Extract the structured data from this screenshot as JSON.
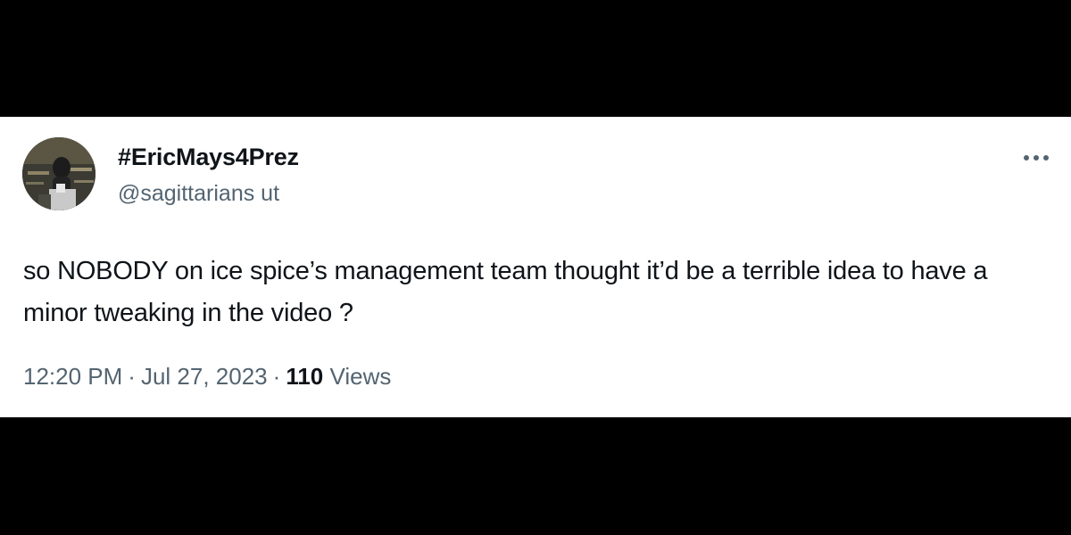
{
  "tweet": {
    "display_name": "#EricMays4Prez",
    "handle": "@sagittarians ut",
    "text": "so NOBODY on ice spice’s management team thought it’d be a terrible idea to have a minor tweaking in the video ?",
    "time": "12:20 PM",
    "date": "Jul 27, 2023",
    "separator": "·",
    "views_count": "110",
    "views_label": "Views",
    "more_icon": "more-horizontal-icon"
  },
  "colors": {
    "background": "#000000",
    "card": "#ffffff",
    "primary_text": "#0f1419",
    "secondary_text": "#536471"
  }
}
